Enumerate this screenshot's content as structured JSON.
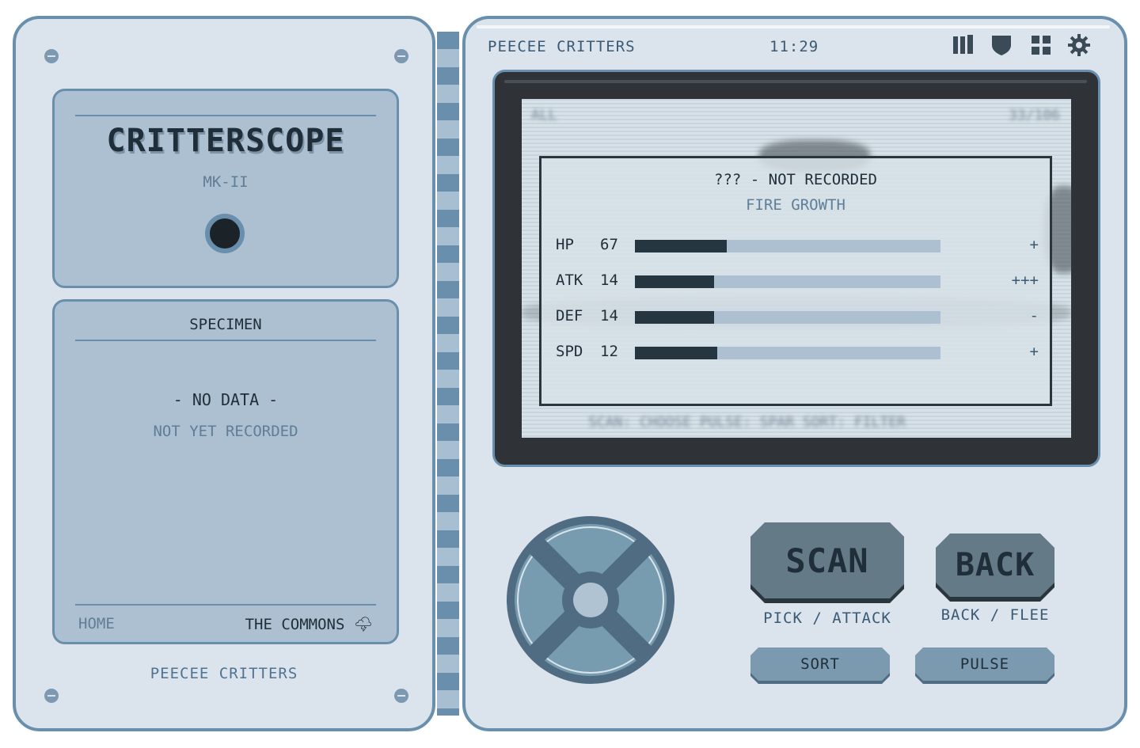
{
  "left": {
    "brand": {
      "title": "CRITTERSCOPE",
      "subtitle": "MK-II"
    },
    "specimen": {
      "title": "SPECIMEN",
      "no_data": "- NO DATA -",
      "not_recorded": "NOT YET RECORDED",
      "location_home": "HOME",
      "location_place": "THE COMMONS 🌩"
    },
    "footer": "PEECEE CRITTERS"
  },
  "topbar": {
    "title": "PEECEE CRITTERS",
    "clock": "11:29",
    "icons": [
      "library-icon",
      "shield-icon",
      "grid-icon",
      "settings-gear-icon"
    ]
  },
  "screen": {
    "background": {
      "filter": "ALL",
      "count": "33/106",
      "hint": "SCAN: CHOOSE   PULSE: SPAR   SORT: FILTER"
    },
    "card": {
      "name": "??? - NOT RECORDED",
      "type": "FIRE GROWTH",
      "stats": [
        {
          "label": "HP",
          "value": "67",
          "fraction": 0.3,
          "mod": "+"
        },
        {
          "label": "ATK",
          "value": "14",
          "fraction": 0.26,
          "mod": "+++"
        },
        {
          "label": "DEF",
          "value": "14",
          "fraction": 0.26,
          "mod": "-"
        },
        {
          "label": "SPD",
          "value": "12",
          "fraction": 0.27,
          "mod": "+"
        }
      ]
    }
  },
  "controls": {
    "scan_label": "SCAN",
    "scan_caption": "PICK / ATTACK",
    "back_label": "BACK",
    "back_caption": "BACK / FLEE",
    "sort_label": "SORT",
    "pulse_label": "PULSE"
  },
  "colors": {
    "panel": "#dbe4ec",
    "border": "#6a8fad",
    "inset": "#adc0d1",
    "screen_bezel": "#2f3337",
    "bar_fill": "#263640",
    "button": "#657a87"
  }
}
